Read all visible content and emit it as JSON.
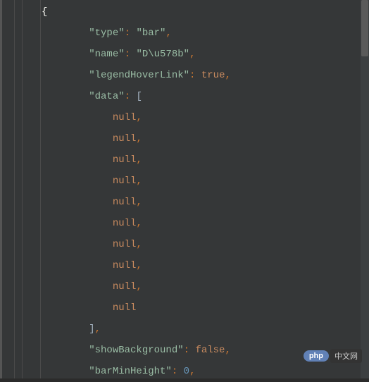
{
  "code": {
    "lines": [
      {
        "indent": 0,
        "tokens": [
          {
            "t": "brace",
            "v": "{"
          }
        ]
      },
      {
        "indent": 2,
        "tokens": [
          {
            "t": "key",
            "v": "\"type\""
          },
          {
            "t": "punct",
            "v": ": "
          },
          {
            "t": "string",
            "v": "\"bar\""
          },
          {
            "t": "punct",
            "v": ","
          }
        ]
      },
      {
        "indent": 2,
        "tokens": [
          {
            "t": "key",
            "v": "\"name\""
          },
          {
            "t": "punct",
            "v": ": "
          },
          {
            "t": "string",
            "v": "\"D\\u578b\""
          },
          {
            "t": "punct",
            "v": ","
          }
        ]
      },
      {
        "indent": 2,
        "tokens": [
          {
            "t": "key",
            "v": "\"legendHoverLink\""
          },
          {
            "t": "punct",
            "v": ": "
          },
          {
            "t": "bool",
            "v": "true"
          },
          {
            "t": "punct",
            "v": ","
          }
        ]
      },
      {
        "indent": 2,
        "tokens": [
          {
            "t": "key",
            "v": "\"data\""
          },
          {
            "t": "punct",
            "v": ": "
          },
          {
            "t": "bracket",
            "v": "["
          }
        ]
      },
      {
        "indent": 3,
        "tokens": [
          {
            "t": "null",
            "v": "null"
          },
          {
            "t": "punct",
            "v": ","
          }
        ]
      },
      {
        "indent": 3,
        "tokens": [
          {
            "t": "null",
            "v": "null"
          },
          {
            "t": "punct",
            "v": ","
          }
        ]
      },
      {
        "indent": 3,
        "tokens": [
          {
            "t": "null",
            "v": "null"
          },
          {
            "t": "punct",
            "v": ","
          }
        ]
      },
      {
        "indent": 3,
        "tokens": [
          {
            "t": "null",
            "v": "null"
          },
          {
            "t": "punct",
            "v": ","
          }
        ]
      },
      {
        "indent": 3,
        "tokens": [
          {
            "t": "null",
            "v": "null"
          },
          {
            "t": "punct",
            "v": ","
          }
        ]
      },
      {
        "indent": 3,
        "tokens": [
          {
            "t": "null",
            "v": "null"
          },
          {
            "t": "punct",
            "v": ","
          }
        ]
      },
      {
        "indent": 3,
        "tokens": [
          {
            "t": "null",
            "v": "null"
          },
          {
            "t": "punct",
            "v": ","
          }
        ]
      },
      {
        "indent": 3,
        "tokens": [
          {
            "t": "null",
            "v": "null"
          },
          {
            "t": "punct",
            "v": ","
          }
        ]
      },
      {
        "indent": 3,
        "tokens": [
          {
            "t": "null",
            "v": "null"
          },
          {
            "t": "punct",
            "v": ","
          }
        ]
      },
      {
        "indent": 3,
        "tokens": [
          {
            "t": "null",
            "v": "null"
          }
        ]
      },
      {
        "indent": 2,
        "tokens": [
          {
            "t": "bracket",
            "v": "]"
          },
          {
            "t": "punct",
            "v": ","
          }
        ]
      },
      {
        "indent": 2,
        "tokens": [
          {
            "t": "key",
            "v": "\"showBackground\""
          },
          {
            "t": "punct",
            "v": ": "
          },
          {
            "t": "bool",
            "v": "false"
          },
          {
            "t": "punct",
            "v": ","
          }
        ]
      },
      {
        "indent": 2,
        "tokens": [
          {
            "t": "key",
            "v": "\"barMinHeight\""
          },
          {
            "t": "punct",
            "v": ": "
          },
          {
            "t": "num",
            "v": "0"
          },
          {
            "t": "punct",
            "v": ","
          }
        ]
      }
    ]
  },
  "watermark": {
    "php": "php",
    "cn": "中文网"
  }
}
